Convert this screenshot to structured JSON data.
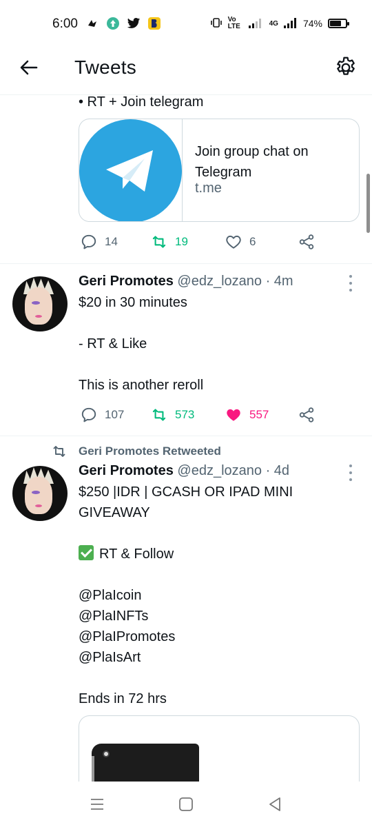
{
  "status_bar": {
    "time": "6:00",
    "network_label": "Vo LTE",
    "network_type": "4G",
    "battery": "74%",
    "battery_level": 0.74
  },
  "header": {
    "title": "Tweets"
  },
  "tweets": [
    {
      "text_tail": "• RT + Join telegram",
      "card": {
        "title": "Join group chat on Telegram",
        "domain": "t.me"
      },
      "replies": "14",
      "retweets": "19",
      "likes": "6"
    },
    {
      "name": "Geri Promotes",
      "handle": "@edz_lozano",
      "separator": "·",
      "time": "4m",
      "lines": [
        "$20 in 30 minutes",
        "- RT & Like",
        "This is another reroll"
      ],
      "replies": "107",
      "retweets": "573",
      "likes": "557",
      "liked": true,
      "retweeted": true
    },
    {
      "context": "Geri Promotes Retweeted",
      "name": "Geri Promotes",
      "handle": "@edz_lozano",
      "separator": "·",
      "time": "4d",
      "line1": "$250 |IDR | GCASH OR IPAD MINI",
      "line2": "GIVEAWAY",
      "follow_line": "RT & Follow",
      "mentions": [
        "@PlaIcoin",
        "@PlaINFTs",
        "@PlaIPromotes",
        "@PlaIsArt"
      ],
      "ends": "Ends in 72 hrs"
    }
  ],
  "colors": {
    "accent": "#1d9bf0",
    "retweet_green": "#00ba7c",
    "like_pink": "#f91880",
    "telegram_blue": "#2ca5e0"
  }
}
